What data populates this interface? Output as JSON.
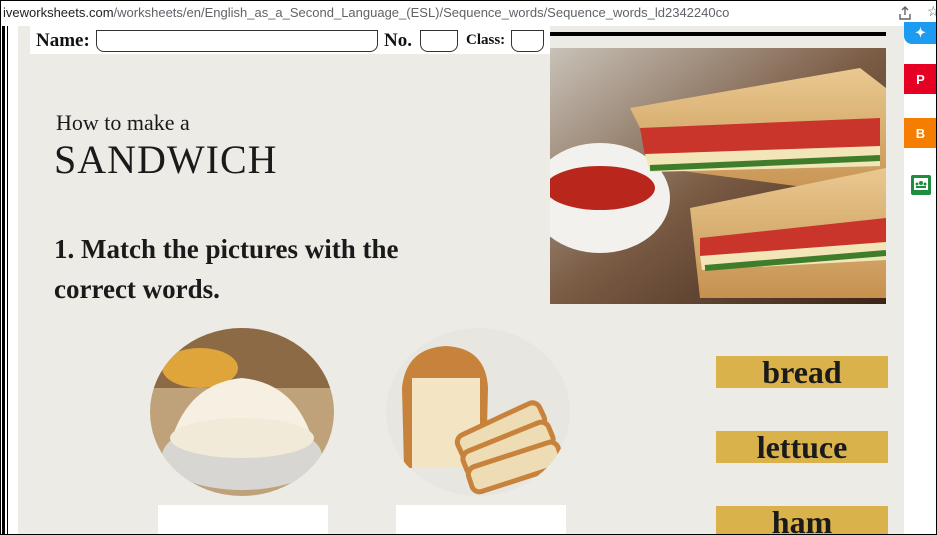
{
  "browser": {
    "url_host": "iveworksheets.com",
    "url_path": "/worksheets/en/English_as_a_Second_Language_(ESL)/Sequence_words/Sequence_words_ld2342240co"
  },
  "header": {
    "name_label": "Name:",
    "no_label": "No.",
    "class_label": "Class:"
  },
  "title": {
    "line1": "How to make a",
    "line2": "SANDWICH"
  },
  "exercise": {
    "instruction": "1. Match the pictures with the correct words."
  },
  "words": [
    "bread",
    "lettuce",
    "ham"
  ],
  "colors": {
    "worksheet_bg": "#ecebe6",
    "word_tile": "#d9b24c",
    "pinterest": "#e60023",
    "blogger": "#f57d00",
    "classroom": "#1e8e3e",
    "twitter": "#1d9bf0"
  },
  "icons": [
    "share-icon",
    "bookmark-star-icon",
    "twitter-icon",
    "pinterest-icon",
    "blogger-icon",
    "google-classroom-icon"
  ]
}
